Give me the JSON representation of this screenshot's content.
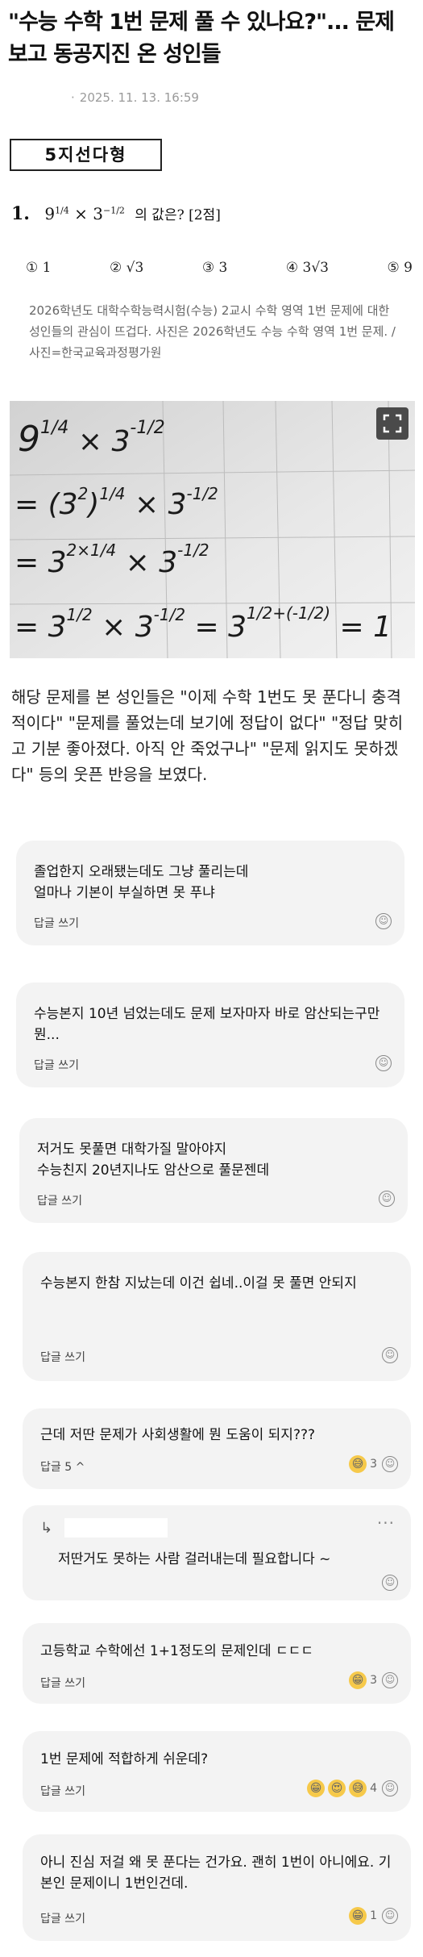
{
  "article": {
    "title": "\"수능 수학 1번 문제 풀 수 있나요?\"... 문제 보고 동공지진 온 성인들",
    "date": "2025. 11. 13. 16:59",
    "badge": "5지선다형",
    "question": {
      "number": "1.",
      "expr_base1": "9",
      "expr_exp1": "1/4",
      "expr_times": "×",
      "expr_base2": "3",
      "expr_exp2": "−1/2",
      "tail": "의 값은? [2점]"
    },
    "choices": [
      "① 1",
      "② √3",
      "③ 3",
      "④ 3√3",
      "⑤ 9"
    ],
    "caption": "2026학년도 대학수학능력시험(수능) 2교시 수학 영역 1번 문제에 대한 성인들의 관심이 뜨겁다. 사진은 2026학년도 수능 수학 영역 1번 문제. /사진=한국교육과정평가원",
    "body": "해당 문제를 본 성인들은 \"이제 수학 1번도 못 푼다니 충격적이다\" \"문제를 풀었는데 보기에 정답이 없다\" \"정답 맞히고 기분 좋아졌다. 아직 안 죽었구나\" \"문제 읽지도 못하겠다\" 등의 웃픈 반응을 보였다."
  },
  "photo": {
    "line1": "9¼ × 3^-½",
    "line2": "= (3²)¼ × 3^-½",
    "line3": "= 3^(2×¼) × 3^-½",
    "line4": "= 3½ × 3^-½ = 3^(½+(-½)) = 1",
    "expand_icon": "expand-icon"
  },
  "comments": [
    {
      "text": "졸업한지 오래됐는데도 그냥 풀리는데\n얼마나 기본이 부실하면 못 푸냐",
      "reply": "답글 쓰기",
      "count": ""
    },
    {
      "text": "수능본지 10년 넘었는데도 문제 보자마자 바로 암산되는구만 뭔...",
      "reply": "답글 쓰기",
      "count": ""
    },
    {
      "text": "저거도 못풀면 대학가질 말아야지\n수능친지 20년지나도 암산으로 풀문젠데",
      "reply": "답글 쓰기",
      "count": ""
    },
    {
      "text": "수능본지 한참 지났는데 이건 쉽네..이걸 못 풀면 안되지",
      "reply": "답글 쓰기",
      "count": ""
    },
    {
      "text": "근데 저딴 문제가 사회생활에 뭔 도움이 되지???",
      "reply": "답글 5 ^",
      "count": "3"
    },
    {
      "text": "저딴거도 못하는 사람 걸러내는데 필요합니다 ~",
      "reply": "",
      "count": ""
    },
    {
      "text": "고등학교 수학에선 1+1정도의 문제인데 ㄷㄷㄷ",
      "reply": "답글 쓰기",
      "count": "3"
    },
    {
      "text": "1번 문제에 적합하게 쉬운데?",
      "reply": "답글 쓰기",
      "count": "4"
    },
    {
      "text": "아니 진심 저걸 왜 못 푼다는 건가요. 괜히 1번이 아니에요. 기본인 문제이니 1번인건데.",
      "reply": "답글 쓰기",
      "count": "1"
    }
  ],
  "colors": {
    "card_bg": "#f3f3f3",
    "muted": "#9a9a9a"
  }
}
